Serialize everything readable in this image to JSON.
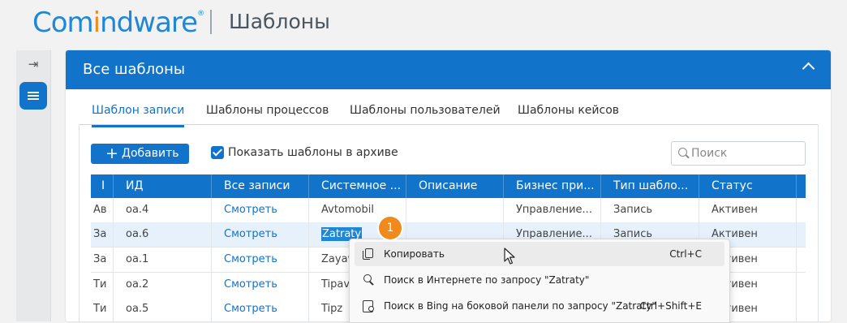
{
  "header": {
    "logo_part1": "Com",
    "logo_part2": "i",
    "logo_part3": "ndware",
    "logo_reg": "®",
    "page_title": "Шаблоны"
  },
  "panel": {
    "title": "Все шаблоны"
  },
  "tabs": [
    {
      "label": "Шаблон записи",
      "active": true
    },
    {
      "label": "Шаблоны процессов",
      "active": false
    },
    {
      "label": "Шаблоны пользователей",
      "active": false
    },
    {
      "label": "Шаблоны кейсов",
      "active": false
    }
  ],
  "toolbar": {
    "add_plus": "+",
    "add_label": "Добавить",
    "show_archive_label": "Показать шаблоны в архиве",
    "show_archive_checked": true,
    "search_placeholder": "Поиск"
  },
  "table": {
    "columns": [
      "I",
      "ИД",
      "Все записи",
      "Системное ...",
      "Описание",
      "Бизнес при...",
      "Тип шабло...",
      "Статус"
    ],
    "rows": [
      [
        "Ав",
        "oa.4",
        "Смотреть",
        "Avtomobil",
        "",
        "Управление...",
        "Запись",
        "Активен"
      ],
      [
        "За",
        "oa.6",
        "Смотреть",
        "Zatraty",
        "",
        "Управление...",
        "Запись",
        "Активен"
      ],
      [
        "За",
        "oa.1",
        "Смотреть",
        "Zayav",
        "",
        "",
        "",
        "Активен"
      ],
      [
        "Ти",
        "oa.2",
        "Смотреть",
        "Tipav",
        "",
        "",
        "",
        "Активен"
      ],
      [
        "Ти",
        "oa.5",
        "Смотреть",
        "Tipz",
        "",
        "",
        "",
        "Активен"
      ]
    ]
  },
  "badge": "1",
  "context_menu": {
    "items": [
      {
        "icon": "copy-icon",
        "label": "Копировать",
        "shortcut": "Ctrl+C"
      },
      {
        "icon": "search-icon",
        "label": "Поиск в Интернете по запросу \"Zatraty\"",
        "shortcut": ""
      },
      {
        "icon": "bing-sidebar-icon",
        "label": "Поиск в Bing на боковой панели по запросу \"Zatraty\"",
        "shortcut": "Ctrl+Shift+E"
      }
    ]
  }
}
